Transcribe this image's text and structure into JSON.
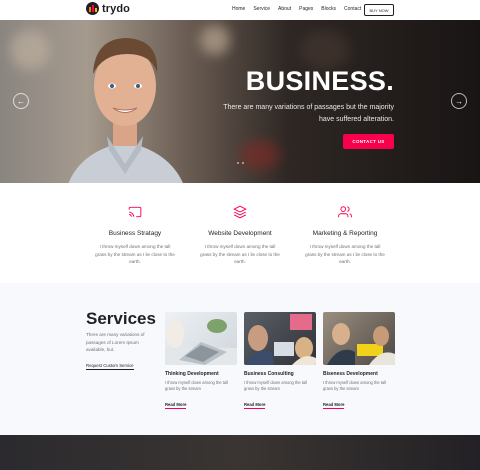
{
  "brand": {
    "name": "trydo"
  },
  "nav": {
    "items": [
      {
        "label": "Home"
      },
      {
        "label": "Service"
      },
      {
        "label": "About"
      },
      {
        "label": "Pages"
      },
      {
        "label": "Blocks"
      },
      {
        "label": "Contact"
      }
    ],
    "cta": "BUY NOW"
  },
  "hero": {
    "title": "BUSINESS.",
    "subtitle": "There are many variations of passages but the majority have suffered alteration.",
    "button": "CONTACT US",
    "prev_icon": "arrow-left-icon",
    "next_icon": "arrow-right-icon"
  },
  "features": [
    {
      "icon": "cast-icon",
      "title": "Business Stratagy",
      "text": "I throw myself down among the tall grass by the stream as I lie close to the earth."
    },
    {
      "icon": "layers-icon",
      "title": "Website Development",
      "text": "I throw myself down among the tall grass by the stream as I lie close to the earth."
    },
    {
      "icon": "users-icon",
      "title": "Marketing & Reporting",
      "text": "I throw myself down among the tall grass by the stream as I lie close to the earth."
    }
  ],
  "services": {
    "title": "Services",
    "description": "There are many variations of passages of Lorem Ipsum available, but.",
    "link": "Request Custom Service",
    "cards": [
      {
        "title": "Thinking Development",
        "text": "I throw myself down among the tall grass by the stream",
        "more": "Read More"
      },
      {
        "title": "Business Consulting",
        "text": "I throw myself down among the tall grass by the stream",
        "more": "Read More"
      },
      {
        "title": "Biseness Development",
        "text": "I throw myself down among the tall grass by the stream",
        "more": "Read More"
      }
    ]
  },
  "colors": {
    "accent": "#f9004d",
    "heading": "#1f1f25",
    "body": "#717173",
    "section_bg": "#f8f9fc"
  }
}
